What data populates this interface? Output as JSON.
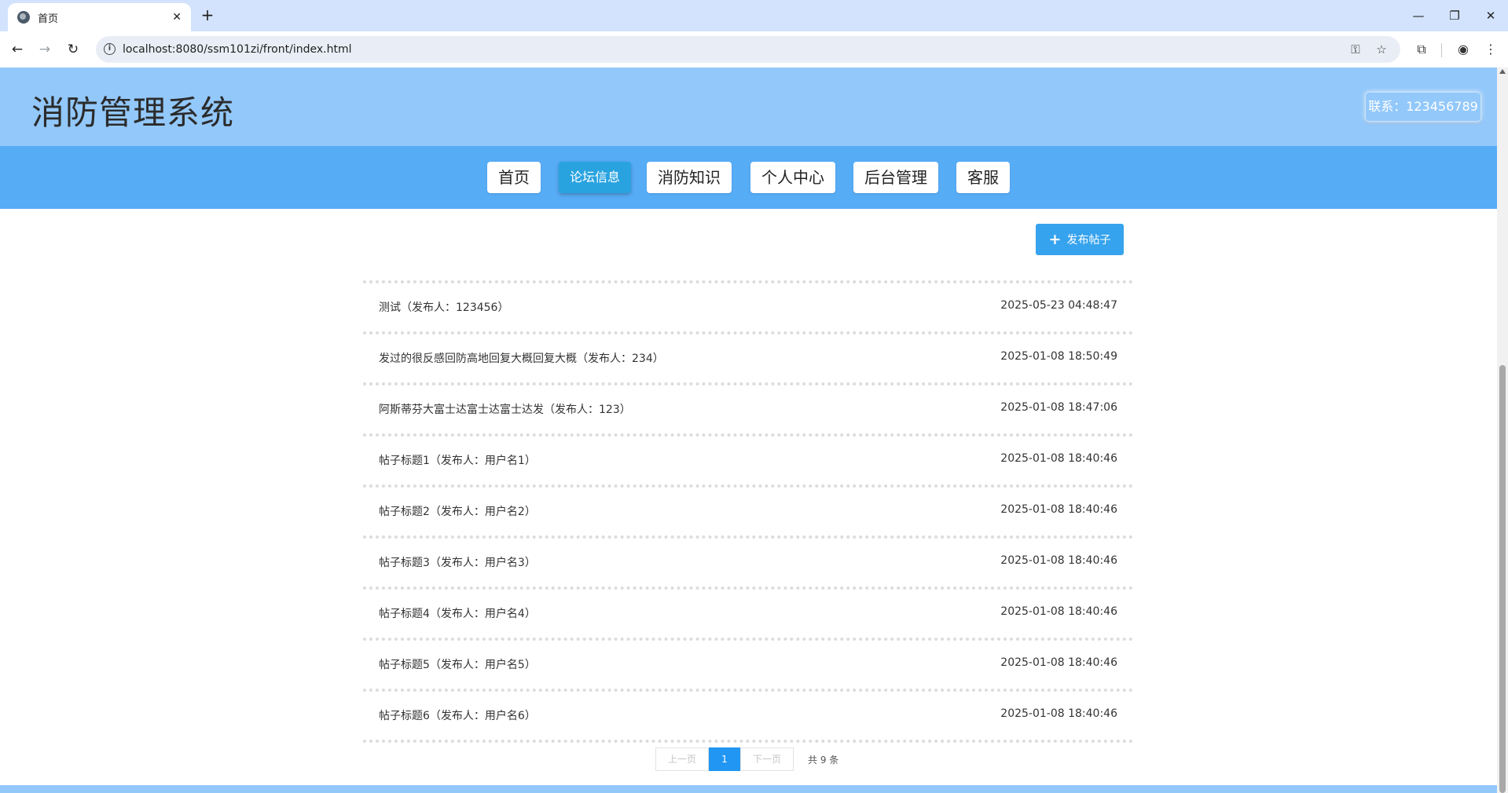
{
  "browser": {
    "tab_title": "首页",
    "tab_close": "✕",
    "new_tab": "+",
    "url": "localhost:8080/ssm101zi/front/index.html",
    "controls": {
      "minimize": "—",
      "restore": "❐",
      "close": "✕"
    }
  },
  "site": {
    "title": "消防管理系统",
    "contact": "联系：123456789"
  },
  "nav": {
    "items": [
      {
        "label": "首页",
        "active": false
      },
      {
        "label": "论坛信息",
        "active": true
      },
      {
        "label": "消防知识",
        "active": false
      },
      {
        "label": "个人中心",
        "active": false
      },
      {
        "label": "后台管理",
        "active": false
      },
      {
        "label": "客服",
        "active": false
      }
    ]
  },
  "forum": {
    "post_button": "发布帖子",
    "posts": [
      {
        "title": "测试（发布人：123456）",
        "time": "2025-05-23 04:48:47"
      },
      {
        "title": "发过的很反感回防高地回复大概回复大概（发布人：234）",
        "time": "2025-01-08 18:50:49"
      },
      {
        "title": "阿斯蒂芬大富士达富士达富士达发（发布人：123）",
        "time": "2025-01-08 18:47:06"
      },
      {
        "title": "帖子标题1（发布人：用户名1）",
        "time": "2025-01-08 18:40:46"
      },
      {
        "title": "帖子标题2（发布人：用户名2）",
        "time": "2025-01-08 18:40:46"
      },
      {
        "title": "帖子标题3（发布人：用户名3）",
        "time": "2025-01-08 18:40:46"
      },
      {
        "title": "帖子标题4（发布人：用户名4）",
        "time": "2025-01-08 18:40:46"
      },
      {
        "title": "帖子标题5（发布人：用户名5）",
        "time": "2025-01-08 18:40:46"
      },
      {
        "title": "帖子标题6（发布人：用户名6）",
        "time": "2025-01-08 18:40:46"
      }
    ]
  },
  "pagination": {
    "prev": "上一页",
    "current": "1",
    "next": "下一页",
    "total": "共 9 条"
  },
  "colors": {
    "header_bg": "#93c8fb",
    "nav_bg": "#57acf6",
    "nav_active": "#29a3e0",
    "primary_button": "#36a3ee",
    "pager_active": "#2196f3"
  }
}
